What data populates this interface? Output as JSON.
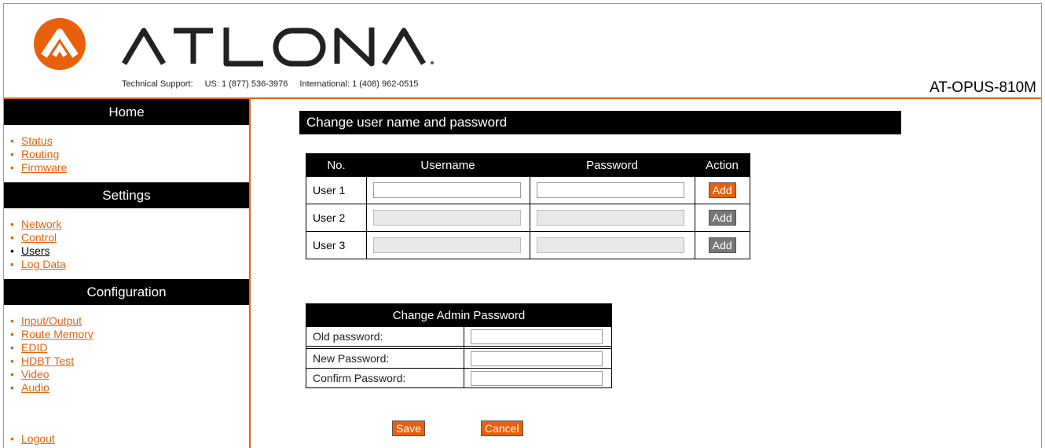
{
  "header": {
    "brand": "ATLONA",
    "support_label": "Technical Support:",
    "support_us": "US: 1 (877) 536-3976",
    "support_intl": "International: 1 (408) 962-0515",
    "model": "AT-OPUS-810M"
  },
  "sidebar": {
    "home": {
      "title": "Home",
      "items": [
        "Status",
        "Routing",
        "Firmware"
      ]
    },
    "settings": {
      "title": "Settings",
      "items": [
        "Network",
        "Control",
        "Users",
        "Log Data"
      ]
    },
    "configuration": {
      "title": "Configuration",
      "items": [
        "Input/Output",
        "Route Memory",
        "EDID",
        "HDBT Test",
        "Video",
        "Audio"
      ]
    },
    "logout": "Logout"
  },
  "main": {
    "title": "Change user name and password",
    "users_table": {
      "headers": [
        "No.",
        "Username",
        "Password",
        "Action"
      ],
      "rows": [
        {
          "no": "User 1",
          "username": "",
          "password": "",
          "action": "Add"
        },
        {
          "no": "User 2",
          "username": "",
          "password": "",
          "action": "Add"
        },
        {
          "no": "User 3",
          "username": "",
          "password": "",
          "action": "Add"
        }
      ]
    },
    "admin": {
      "title": "Change Admin Password",
      "old_label": "Old password:",
      "new_label": "New Password:",
      "confirm_label": "Confirm Password:"
    },
    "save": "Save",
    "cancel": "Cancel"
  },
  "colors": {
    "accent": "#e8600c",
    "header_bg": "#000000",
    "disabled_button": "#777777"
  }
}
